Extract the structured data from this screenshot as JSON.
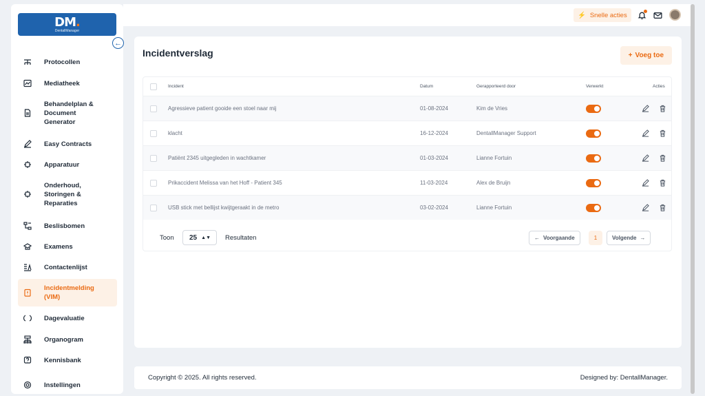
{
  "logo": {
    "mark": "DM",
    "brand": "DentallManager"
  },
  "sidebar": {
    "items": [
      {
        "label": "Protocollen",
        "icon": "hierarchy-icon",
        "active": false
      },
      {
        "label": "Mediatheek",
        "icon": "chart-icon",
        "active": false
      },
      {
        "label": "Behandelplan & Document Generator",
        "icon": "document-icon",
        "active": false
      },
      {
        "label": "Easy Contracts",
        "icon": "pen-icon",
        "active": false
      },
      {
        "label": "Apparatuur",
        "icon": "gear-icon",
        "active": false
      },
      {
        "label": "Onderhoud, Storingen & Reparaties",
        "icon": "wrench-icon",
        "active": false
      },
      {
        "label": "Beslisbomen",
        "icon": "tree-icon",
        "active": false
      },
      {
        "label": "Examens",
        "icon": "graduation-icon",
        "active": false
      },
      {
        "label": "Contactenlijst",
        "icon": "contacts-icon",
        "active": false
      },
      {
        "label": "Incidentmelding (VIM)",
        "icon": "alert-icon",
        "active": true
      },
      {
        "label": "Dagevaluatie",
        "icon": "refresh-icon",
        "active": false
      },
      {
        "label": "Organogram",
        "icon": "org-icon",
        "active": false
      },
      {
        "label": "Kennisbank",
        "icon": "question-icon",
        "active": false
      },
      {
        "label": "Instellingen",
        "icon": "settings-icon",
        "active": false
      }
    ]
  },
  "topbar": {
    "quick_label": "Snelle acties"
  },
  "page": {
    "title": "Incidentverslag",
    "add_label": "Voeg toe"
  },
  "table": {
    "headers": {
      "incident": "Incident",
      "datum": "Datum",
      "gerapporteerd": "Gerapporteerd door",
      "verwerkt": "Verwerkt",
      "acties": "Acties"
    },
    "rows": [
      {
        "incident": "Agressieve patient gooide een stoel naar mij",
        "datum": "01-08-2024",
        "door": "Kim de Vries",
        "verwerkt": true
      },
      {
        "incident": "klacht",
        "datum": "16-12-2024",
        "door": "DentallManager Support",
        "verwerkt": true
      },
      {
        "incident": "Patiënt 2345 uitgegleden in wachtkamer",
        "datum": "01-03-2024",
        "door": "Lianne Fortuin",
        "verwerkt": true
      },
      {
        "incident": "Prikaccident Melissa van het Hoff - Patient 345",
        "datum": "11-03-2024",
        "door": "Alex de Bruijn",
        "verwerkt": true
      },
      {
        "incident": "USB stick met bellijst kwijtgeraakt in de metro",
        "datum": "03-02-2024",
        "door": "Lianne Fortuin",
        "verwerkt": true
      }
    ]
  },
  "pagination": {
    "toon": "Toon",
    "per_page": "25",
    "resultaten": "Resultaten",
    "prev": "Voorgaande",
    "current": "1",
    "next": "Volgende"
  },
  "footer": {
    "copyright": "Copyright © 2025. All rights reserved.",
    "designed": "Designed by: DentallManager."
  },
  "colors": {
    "accent": "#ea6a12",
    "brand": "#1f63ad"
  }
}
